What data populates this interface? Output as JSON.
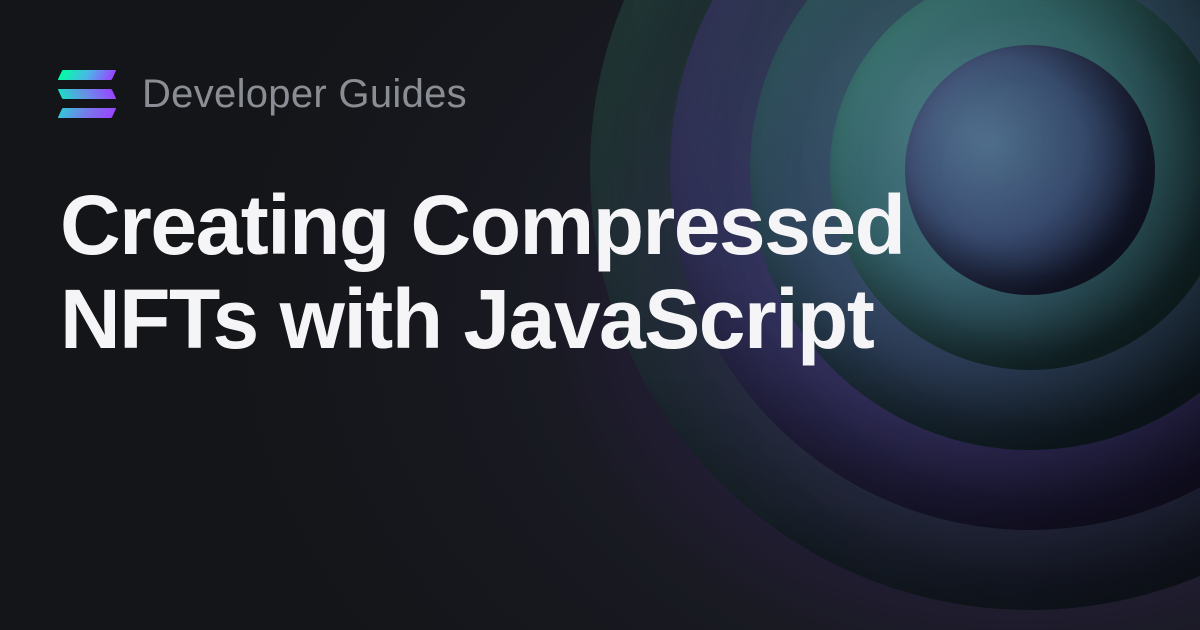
{
  "header": {
    "subtitle": "Developer Guides",
    "logo_name": "solana-logo"
  },
  "main": {
    "title": "Creating Compressed NFTs with JavaScript"
  }
}
